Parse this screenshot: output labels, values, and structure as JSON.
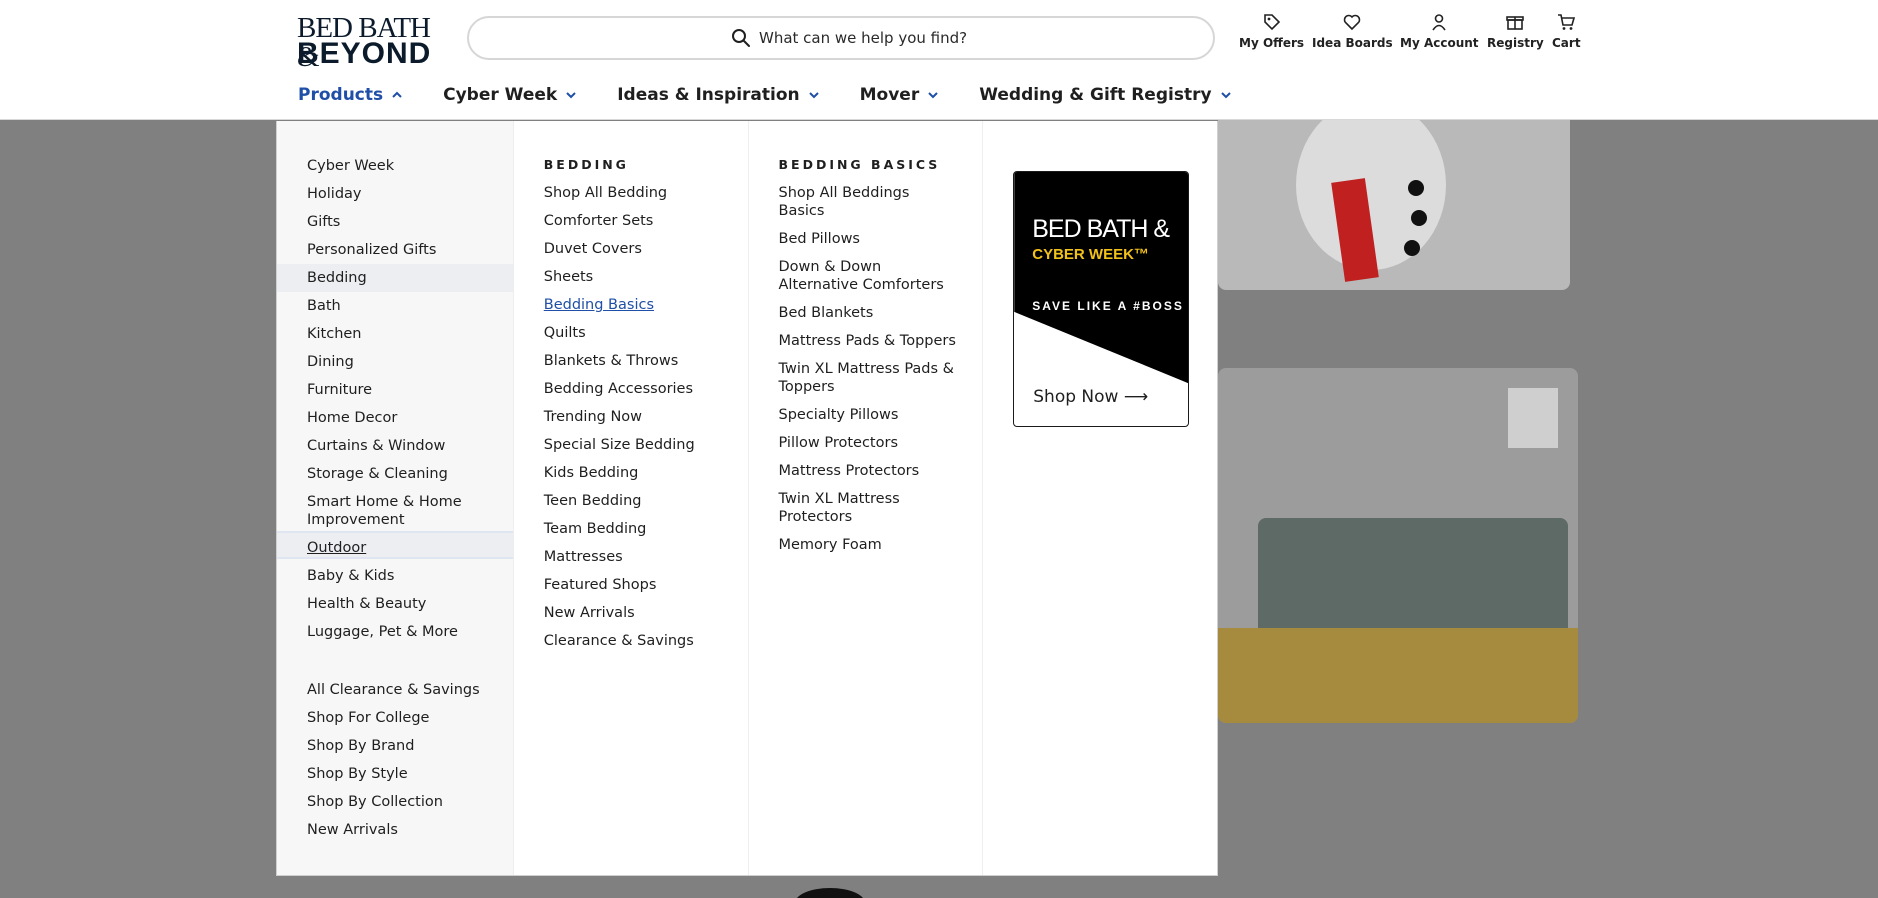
{
  "header": {
    "logo_line1": "BED BATH &",
    "logo_line2": "BEYOND",
    "search_placeholder": "What can we help you find?",
    "utility": [
      {
        "label": "My Offers",
        "icon": "tag-icon"
      },
      {
        "label": "Idea Boards",
        "icon": "heart-icon"
      },
      {
        "label": "My Account",
        "icon": "user-icon"
      },
      {
        "label": "Registry",
        "icon": "gift-icon"
      },
      {
        "label": "Cart",
        "icon": "cart-icon"
      }
    ]
  },
  "nav": [
    {
      "label": "Products",
      "active": true
    },
    {
      "label": "Cyber Week"
    },
    {
      "label": "Ideas & Inspiration"
    },
    {
      "label": "Mover"
    },
    {
      "label": "Wedding & Gift Registry"
    }
  ],
  "categories": [
    "Cyber Week",
    "Holiday",
    "Gifts",
    "Personalized Gifts",
    "Bedding",
    "Bath",
    "Kitchen",
    "Dining",
    "Furniture",
    "Home Decor",
    "Curtains & Window",
    "Storage & Cleaning",
    "Smart Home & Home Improvement",
    "Outdoor",
    "Baby & Kids",
    "Health & Beauty",
    "Luggage, Pet & More"
  ],
  "categories_extra": [
    "All Clearance & Savings",
    "Shop For College",
    "Shop By Brand",
    "Shop By Style",
    "Shop By Collection",
    "New Arrivals"
  ],
  "bedding": {
    "heading": "BEDDING",
    "items": [
      "Shop All Bedding",
      "Comforter Sets",
      "Duvet Covers",
      "Sheets",
      "Bedding Basics",
      "Quilts",
      "Blankets & Throws",
      "Bedding Accessories",
      "Trending Now",
      "Special Size Bedding",
      "Kids Bedding",
      "Teen Bedding",
      "Team Bedding",
      "Mattresses",
      "Featured Shops",
      "New Arrivals",
      "Clearance & Savings"
    ]
  },
  "basics": {
    "heading": "BEDDING BASICS",
    "items": [
      "Shop All Beddings Basics",
      "Bed Pillows",
      "Down & Down Alternative Comforters",
      "Bed Blankets",
      "Mattress Pads & Toppers",
      "Twin XL Mattress Pads & Toppers",
      "Specialty Pillows",
      "Pillow Protectors",
      "Mattress Protectors",
      "Twin XL Mattress Protectors",
      "Memory Foam"
    ]
  },
  "promo": {
    "line1": "BED BATH &",
    "line2": "CYBER WEEK™",
    "line3": "SAVE LIKE A #BOSS",
    "cta": "Shop Now ⟶"
  }
}
